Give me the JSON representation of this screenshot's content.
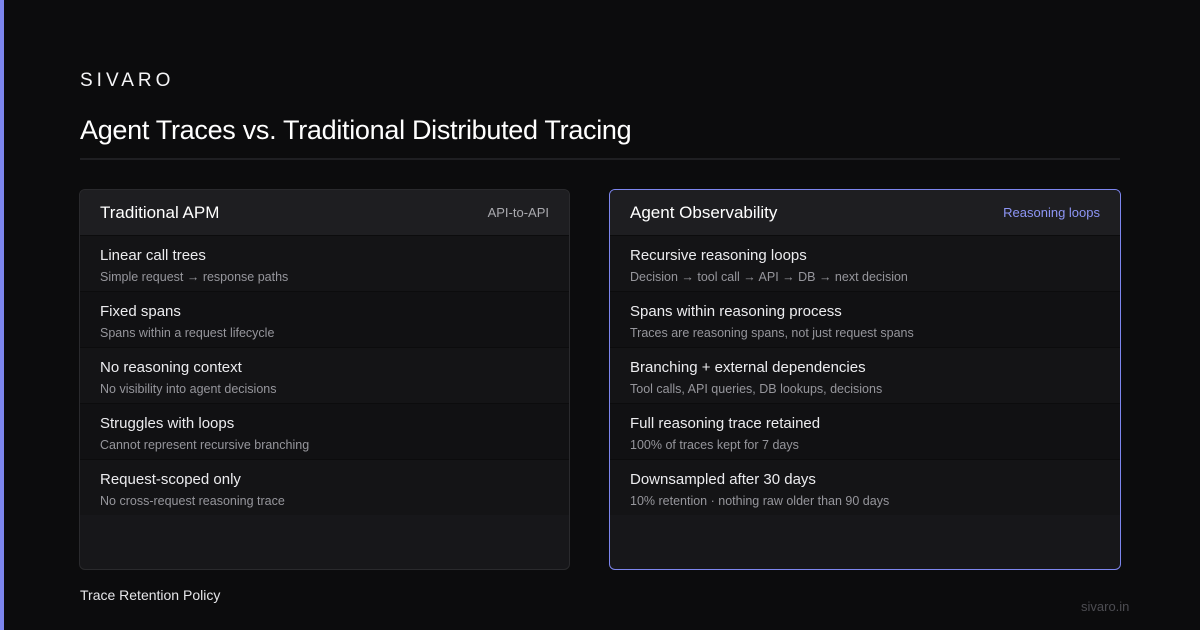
{
  "brand": "SIVARO",
  "title": "Agent Traces vs. Traditional Distributed Tracing",
  "left_card": {
    "title": "Traditional APM",
    "tag": "API-to-API",
    "rows": [
      {
        "title": "Linear call trees",
        "sub": "Simple request → response paths"
      },
      {
        "title": "Fixed spans",
        "sub": "Spans within a request lifecycle"
      },
      {
        "title": "No reasoning context",
        "sub": "No visibility into agent decisions"
      },
      {
        "title": "Struggles with loops",
        "sub": "Cannot represent recursive branching"
      },
      {
        "title": "Request-scoped only",
        "sub": "No cross-request reasoning trace"
      }
    ]
  },
  "right_card": {
    "title": "Agent Observability",
    "tag": "Reasoning loops",
    "rows": [
      {
        "title": "Recursive reasoning loops",
        "sub": "Decision → tool call → API → DB → next decision"
      },
      {
        "title": "Spans within reasoning process",
        "sub": "Traces are reasoning spans, not just request spans"
      },
      {
        "title": "Branching + external dependencies",
        "sub": "Tool calls, API queries, DB lookups, decisions"
      },
      {
        "title": "Full reasoning trace retained",
        "sub": "100% of traces kept for 7 days"
      },
      {
        "title": "Downsampled after 30 days",
        "sub": "10% retention · nothing raw older than 90 days"
      }
    ]
  },
  "footer": {
    "caption": "Trace Retention Policy",
    "site": "sivaro.in"
  },
  "colors": {
    "background": "#0c0c0d",
    "accent": "#7d86ee",
    "card": "#17171a"
  }
}
